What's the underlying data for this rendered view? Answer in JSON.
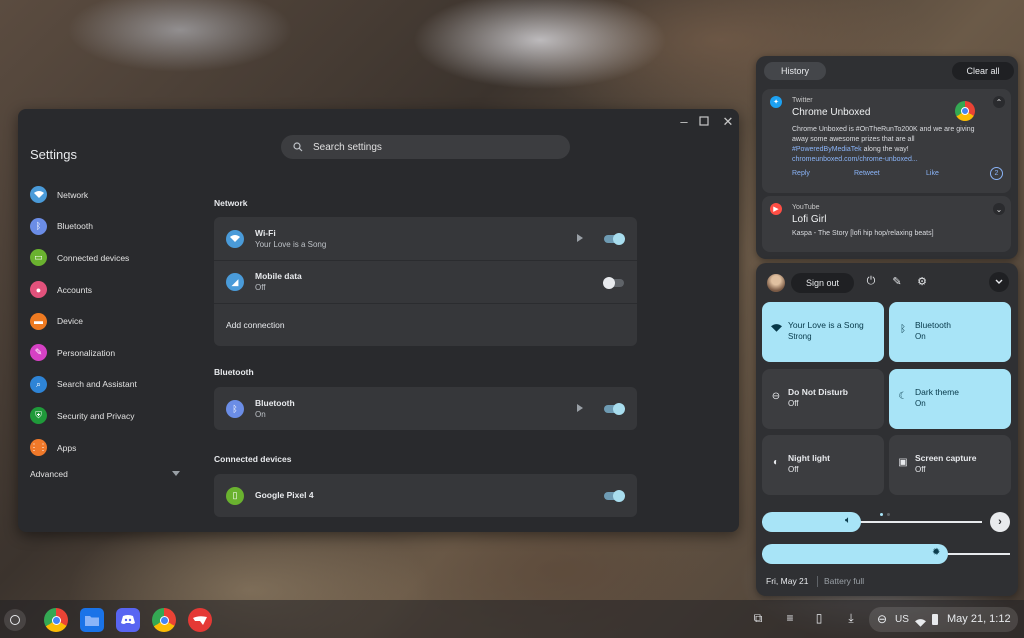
{
  "settings": {
    "title": "Settings",
    "search_placeholder": "Search settings",
    "nav": [
      {
        "label": "Network",
        "color": "#4a9bd9"
      },
      {
        "label": "Bluetooth",
        "color": "#6b8de6"
      },
      {
        "label": "Connected devices",
        "color": "#6ab22f"
      },
      {
        "label": "Accounts",
        "color": "#e2527c"
      },
      {
        "label": "Device",
        "color": "#ee7a21"
      },
      {
        "label": "Personalization",
        "color": "#d541c4"
      },
      {
        "label": "Search and Assistant",
        "color": "#2e84d6"
      },
      {
        "label": "Security and Privacy",
        "color": "#1f9a3a"
      },
      {
        "label": "Apps",
        "color": "#f0792a"
      }
    ],
    "advanced": "Advanced",
    "sections": {
      "network": {
        "title": "Network",
        "wifi_title": "Wi-Fi",
        "wifi_sub": "Your Love is a Song",
        "mobile_title": "Mobile data",
        "mobile_sub": "Off",
        "add_connection": "Add connection"
      },
      "bluetooth": {
        "title": "Bluetooth",
        "item_title": "Bluetooth",
        "item_sub": "On"
      },
      "connected": {
        "title": "Connected devices",
        "item_title": "Google Pixel 4"
      }
    }
  },
  "notifications": {
    "history": "History",
    "clear_all": "Clear all",
    "twitter": {
      "app": "Twitter",
      "title": "Chrome Unboxed",
      "body_1": "Chrome Unboxed is #OnTheRunTo200K and we are giving away some awesome prizes that are all ",
      "body_link": "#PoweredByMediaTek",
      "body_2": " along the way!",
      "link": "chromeunboxed.com/chrome-unboxed...",
      "reply": "Reply",
      "retweet": "Retweet",
      "like": "Like",
      "badge": "2"
    },
    "youtube": {
      "app": "YouTube",
      "title": "Lofi Girl",
      "body": "Kaspa - The Story [lofi hip hop/relaxing beats]"
    }
  },
  "quick_settings": {
    "sign_out": "Sign out",
    "tiles": {
      "wifi_title": "Your Love is a Song",
      "wifi_sub": "Strong",
      "bt_title": "Bluetooth",
      "bt_sub": "On",
      "dnd_title": "Do Not Disturb",
      "dnd_sub": "Off",
      "dark_title": "Dark theme",
      "dark_sub": "On",
      "night_title": "Night light",
      "night_sub": "Off",
      "capture_title": "Screen capture",
      "capture_sub": "Off"
    },
    "volume_level": 0.45,
    "brightness_level": 0.75,
    "date": "Fri, May 21",
    "battery": "Battery full"
  },
  "shelf": {
    "ime": "US",
    "time": "May 21, 1:12"
  }
}
